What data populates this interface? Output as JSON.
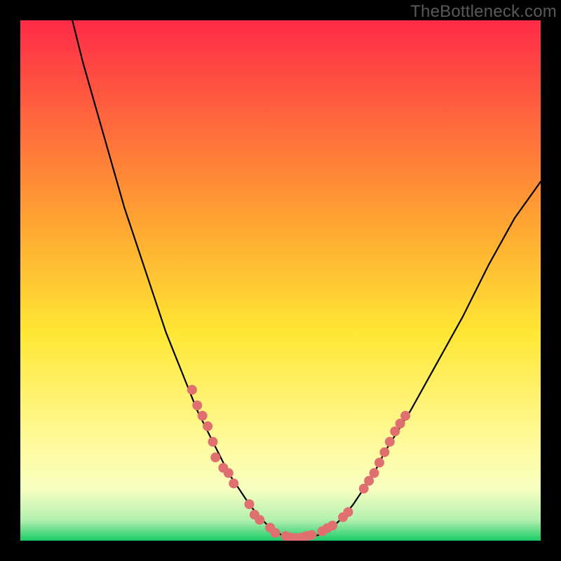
{
  "watermark": "TheBottleneck.com",
  "colors": {
    "page_bg": "#000000",
    "curve": "#000000",
    "dot_fill": "#e07070",
    "dot_stroke": "#d45a5a",
    "gradient_stops": [
      {
        "offset": "0%",
        "color": "#ff2b48"
      },
      {
        "offset": "38%",
        "color": "#ffa232"
      },
      {
        "offset": "60%",
        "color": "#ffe734"
      },
      {
        "offset": "82%",
        "color": "#fffb9f"
      },
      {
        "offset": "90%",
        "color": "#f8ffc0"
      },
      {
        "offset": "96%",
        "color": "#b4f0b0"
      },
      {
        "offset": "100%",
        "color": "#1acb66"
      }
    ]
  },
  "chart_data": {
    "type": "line",
    "title": "",
    "xlabel": "",
    "ylabel": "",
    "xlim": [
      0,
      100
    ],
    "ylim": [
      0,
      100
    ],
    "curve": {
      "x": [
        10,
        12,
        14,
        16,
        18,
        20,
        22,
        24,
        26,
        28,
        30,
        32,
        34,
        36,
        38,
        40,
        42,
        44,
        46,
        48,
        50,
        52,
        54,
        56,
        58,
        60,
        62,
        64,
        66,
        68,
        70,
        75,
        80,
        85,
        90,
        95,
        100
      ],
      "y": [
        100,
        92,
        85,
        78,
        71,
        64,
        58,
        52,
        46,
        40,
        35,
        30,
        25,
        21,
        17,
        13,
        10,
        7,
        4.5,
        2.5,
        1.2,
        0.6,
        0.5,
        0.7,
        1.3,
        2.6,
        4.5,
        7,
        10,
        13,
        17,
        25,
        34,
        43,
        53,
        62,
        69
      ]
    },
    "dots": [
      {
        "x": 33,
        "y": 29
      },
      {
        "x": 34,
        "y": 26
      },
      {
        "x": 35,
        "y": 24
      },
      {
        "x": 36,
        "y": 22
      },
      {
        "x": 37,
        "y": 19
      },
      {
        "x": 37.5,
        "y": 16
      },
      {
        "x": 39,
        "y": 14
      },
      {
        "x": 40,
        "y": 13
      },
      {
        "x": 41,
        "y": 11
      },
      {
        "x": 44,
        "y": 7
      },
      {
        "x": 45,
        "y": 5
      },
      {
        "x": 46,
        "y": 4
      },
      {
        "x": 48,
        "y": 2.5
      },
      {
        "x": 49,
        "y": 1.5
      },
      {
        "x": 51,
        "y": 0.9
      },
      {
        "x": 52,
        "y": 0.6
      },
      {
        "x": 53,
        "y": 0.5
      },
      {
        "x": 54,
        "y": 0.6
      },
      {
        "x": 55,
        "y": 0.9
      },
      {
        "x": 56,
        "y": 1.1
      },
      {
        "x": 58,
        "y": 1.8
      },
      {
        "x": 59,
        "y": 2.4
      },
      {
        "x": 60,
        "y": 2.9
      },
      {
        "x": 62,
        "y": 4.5
      },
      {
        "x": 63,
        "y": 5.5
      },
      {
        "x": 66,
        "y": 10
      },
      {
        "x": 67,
        "y": 11.5
      },
      {
        "x": 68,
        "y": 13
      },
      {
        "x": 69,
        "y": 15
      },
      {
        "x": 70,
        "y": 17
      },
      {
        "x": 71,
        "y": 19
      },
      {
        "x": 72,
        "y": 21
      },
      {
        "x": 73,
        "y": 22.5
      },
      {
        "x": 74,
        "y": 24
      }
    ],
    "dot_radius": 7
  }
}
